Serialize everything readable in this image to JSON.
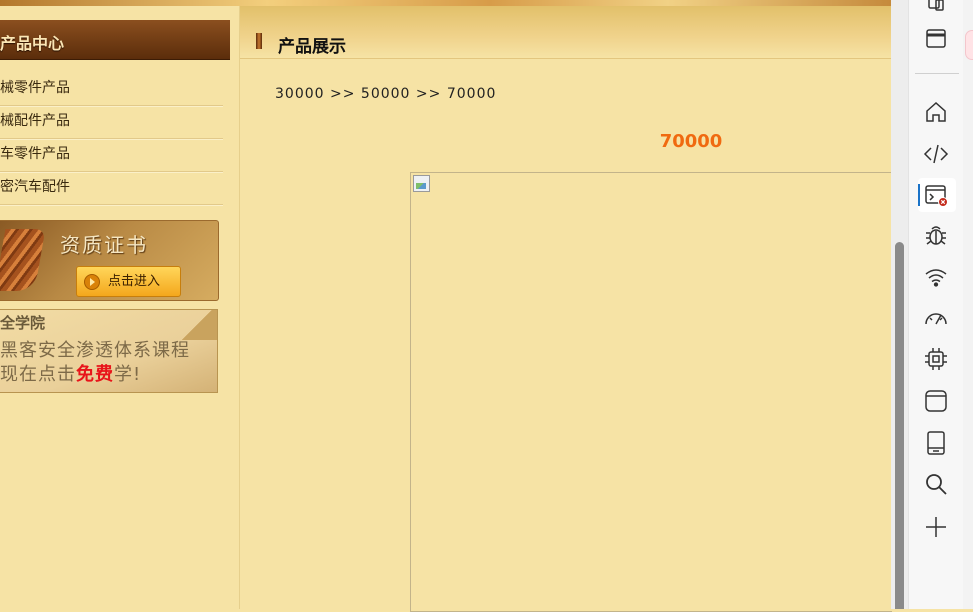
{
  "sidebar": {
    "category_header": "产品中心",
    "categories": [
      "械零件产品",
      "械配件产品",
      "车零件产品",
      "密汽车配件"
    ],
    "banner_cert": {
      "title": "资质证书",
      "button": "点击进入"
    },
    "banner_ad": {
      "line1": "全学院",
      "line2": "黑客安全渗透体系课程",
      "line3_prefix": "现在点击",
      "line3_free": "免费",
      "line3_suffix": "学!"
    }
  },
  "main": {
    "header_title": "产品展示",
    "breadcrumb": [
      "30000",
      ">>",
      "50000",
      ">>",
      "70000"
    ],
    "product_title": "70000"
  },
  "devtools": {
    "icons": [
      "device-emulation-icon",
      "dock-window-icon",
      "home-icon",
      "code-icon",
      "console-icon",
      "bug-icon",
      "network-wifi-icon",
      "performance-gauge-icon",
      "cpu-chip-icon",
      "application-window-icon",
      "tablet-device-icon",
      "search-icon",
      "add-tool-icon"
    ],
    "console_error_badge": "×"
  },
  "colors": {
    "page_bg": "#f6e3a5",
    "product_title": "#f06a10",
    "accent_blue": "#1a73c8"
  }
}
